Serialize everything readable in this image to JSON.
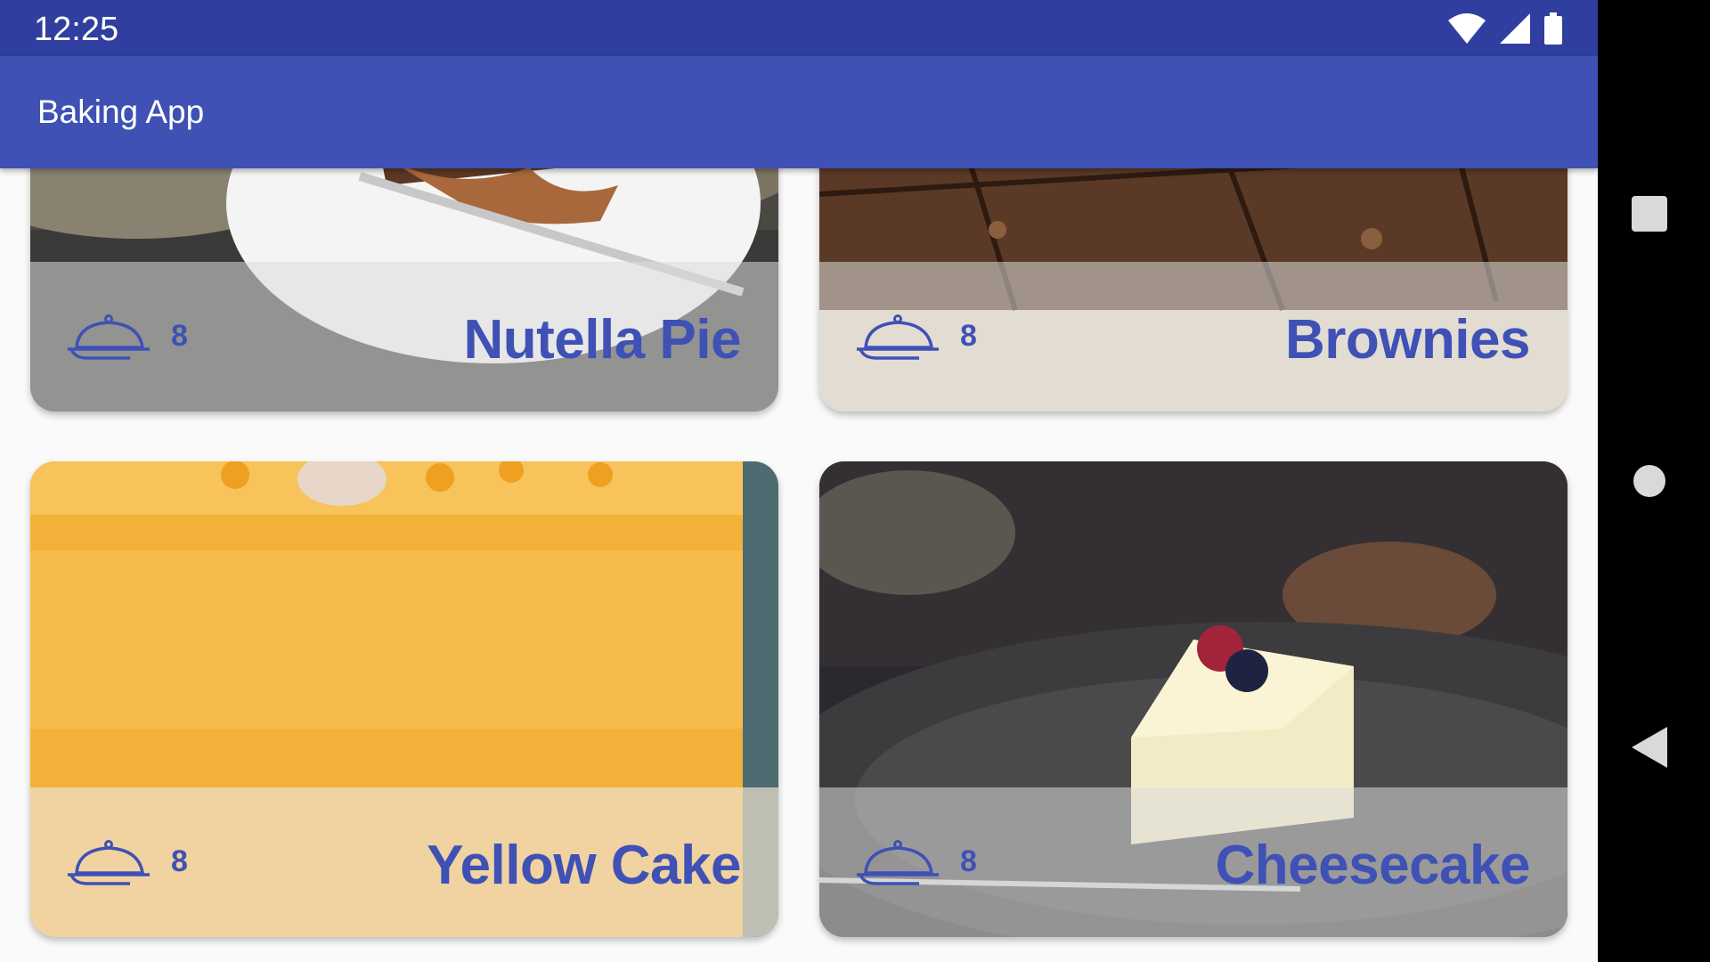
{
  "status_bar": {
    "time": "12:25",
    "icons": [
      "wifi-icon",
      "signal-icon",
      "battery-icon"
    ]
  },
  "app_bar": {
    "title": "Baking App"
  },
  "recipes": [
    {
      "name": "Nutella Pie",
      "servings": "8",
      "image": "nutella-pie-photo"
    },
    {
      "name": "Brownies",
      "servings": "8",
      "image": "brownies-photo"
    },
    {
      "name": "Yellow Cake",
      "servings": "8",
      "image": "yellow-cake-photo"
    },
    {
      "name": "Cheesecake",
      "servings": "8",
      "image": "cheesecake-photo"
    }
  ],
  "nav_bar": {
    "buttons": [
      "recents-button",
      "home-button",
      "back-button"
    ]
  },
  "colors": {
    "primary": "#3f51b5",
    "primary_dark": "#303f9f",
    "background": "#fafafa"
  }
}
